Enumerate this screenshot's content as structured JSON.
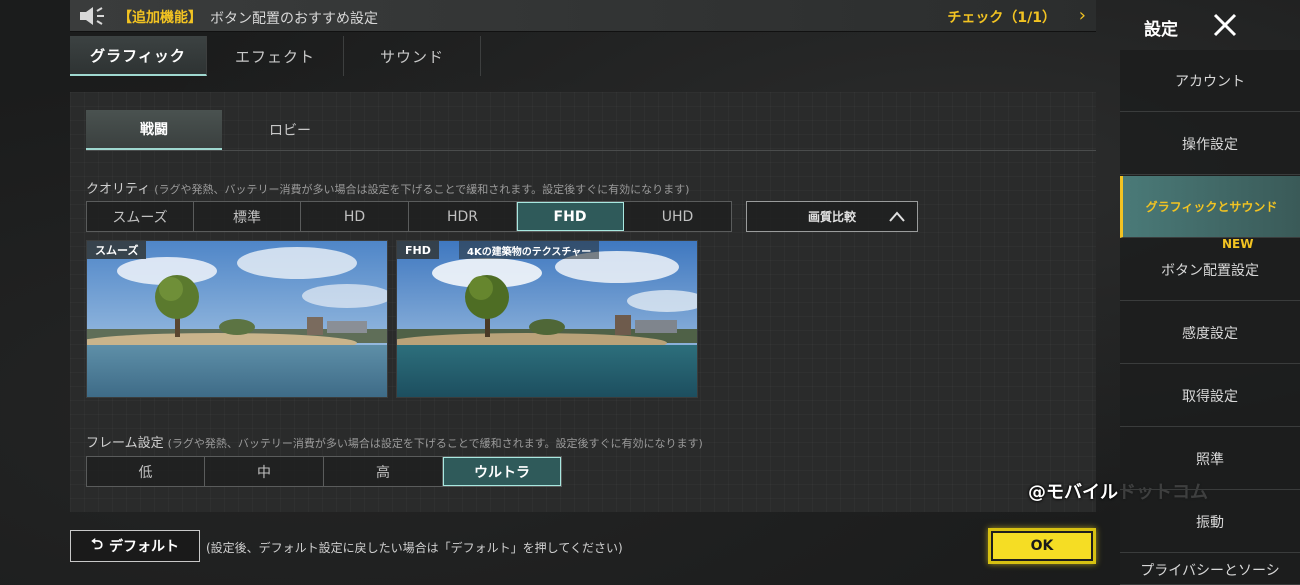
{
  "announcement": {
    "tag": "【追加機能】",
    "text": "ボタン配置のおすすめ設定",
    "check": "チェック（1/1）",
    "chevron": "›"
  },
  "tabs": [
    {
      "label": "グラフィック",
      "active": true
    },
    {
      "label": "エフェクト",
      "active": false
    },
    {
      "label": "サウンド",
      "active": false
    }
  ],
  "subtabs": [
    {
      "label": "戦闘",
      "active": true
    },
    {
      "label": "ロビー",
      "active": false
    }
  ],
  "quality": {
    "label": "クオリティ",
    "hint": "(ラグや発熱、バッテリー消費が多い場合は設定を下げることで緩和されます。設定後すぐに有効になります)",
    "options": [
      "スムーズ",
      "標準",
      "HD",
      "HDR",
      "FHD",
      "UHD"
    ],
    "selected": "FHD",
    "compare_label": "画質比較"
  },
  "previews": {
    "left_tag": "スムーズ",
    "right_tag": "FHD",
    "right_note": "4Kの建築物のテクスチャー"
  },
  "frame": {
    "label": "フレーム設定",
    "hint": "(ラグや発熱、バッテリー消費が多い場合は設定を下げることで緩和されます。設定後すぐに有効になります)",
    "options": [
      "低",
      "中",
      "高",
      "ウルトラ"
    ],
    "selected": "ウルトラ"
  },
  "footer": {
    "default_label": "デフォルト",
    "default_hint": "(設定後、デフォルト設定に戻したい場合は「デフォルト」を押してください)",
    "ok_label": "OK"
  },
  "watermark": "@モバイルドットコム",
  "sidebar": {
    "title": "設定",
    "new_badge": "NEW",
    "items": [
      {
        "label": "アカウント"
      },
      {
        "label": "操作設定"
      },
      {
        "label": "グラフィックとサウンド",
        "active": true
      },
      {
        "label": "ボタン配置設定"
      },
      {
        "label": "感度設定"
      },
      {
        "label": "取得設定"
      },
      {
        "label": "照準"
      },
      {
        "label": "振動"
      },
      {
        "label": "プライバシーとソーシ"
      }
    ]
  },
  "colors": {
    "accent_yellow": "#f2c322",
    "active_teal": "#2f5a5a",
    "ok_yellow": "#f5dd24"
  }
}
